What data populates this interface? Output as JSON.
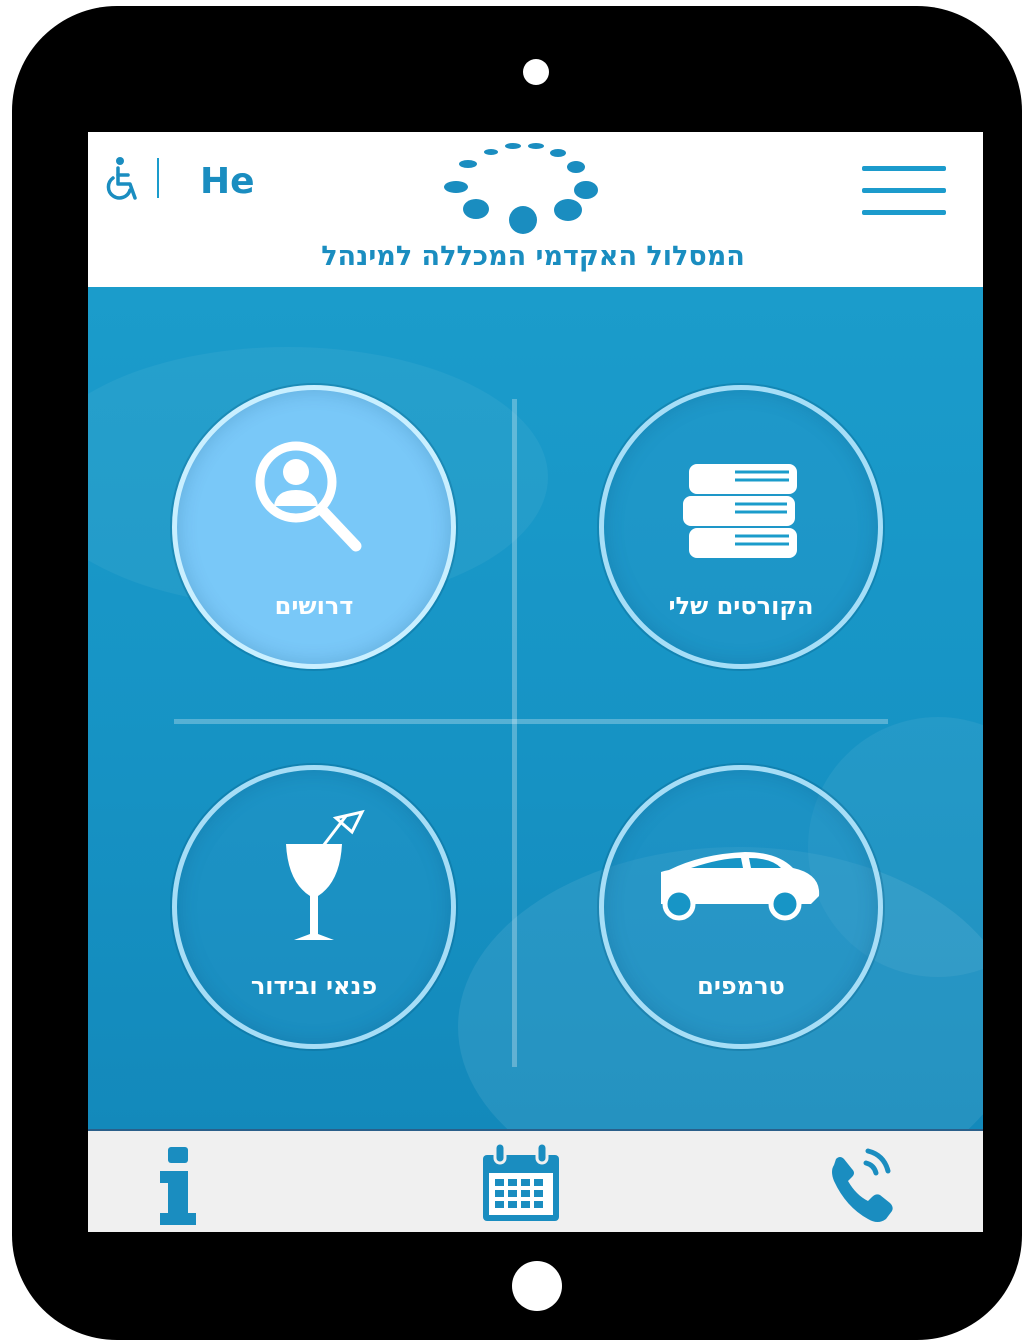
{
  "header": {
    "language_label": "He",
    "title": "המסלול האקדמי המכללה למינהל",
    "accessibility_icon": "wheelchair-icon",
    "menu_icon": "hamburger-menu-icon"
  },
  "tiles": [
    {
      "label": "דרושים",
      "icon": "search-person-icon",
      "active": true
    },
    {
      "label": "הקורסים שלי",
      "icon": "books-icon",
      "active": false
    },
    {
      "label": "פנאי ובידור",
      "icon": "cocktail-icon",
      "active": false
    },
    {
      "label": "טרמפים",
      "icon": "car-icon",
      "active": false
    }
  ],
  "bottom_nav": [
    {
      "icon": "info-icon"
    },
    {
      "icon": "calendar-icon"
    },
    {
      "icon": "phone-icon"
    }
  ],
  "colors": {
    "brand": "#1a8dc0",
    "background": "#1795c6",
    "active_tile": "#79c8f8",
    "bottom_bar": "#f0f0f0"
  }
}
